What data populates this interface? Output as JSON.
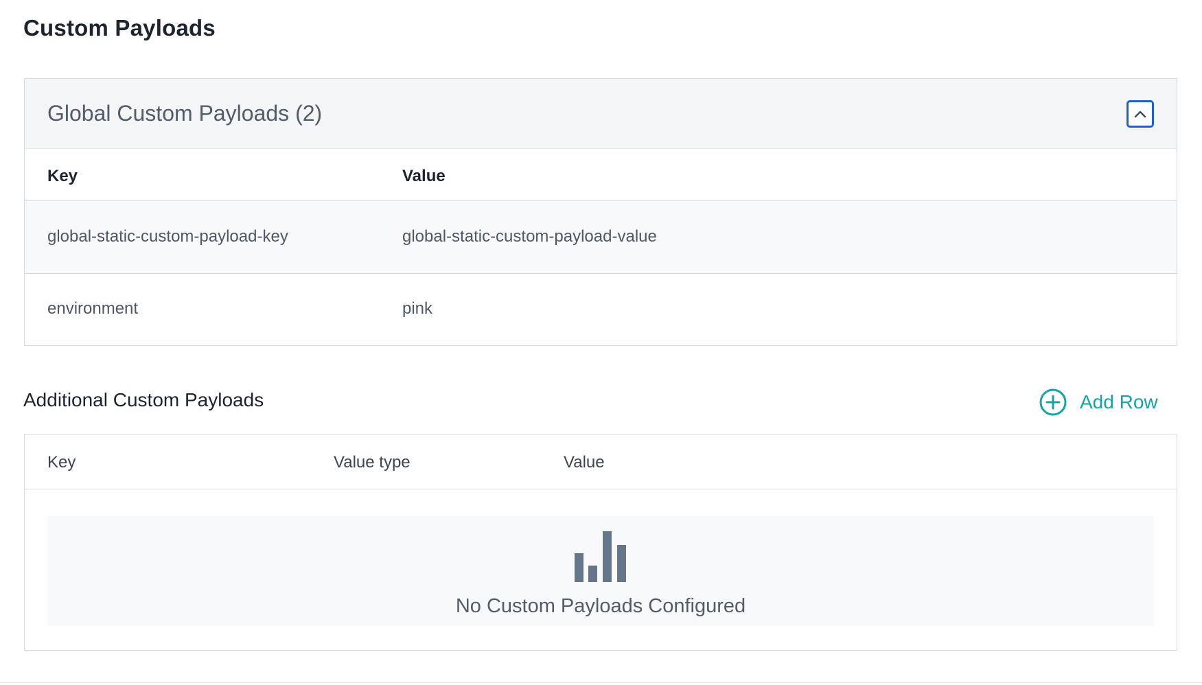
{
  "page": {
    "title": "Custom Payloads"
  },
  "global": {
    "title": "Global Custom Payloads (2)",
    "collapse_icon": "chevron-up-icon",
    "columns": {
      "key": "Key",
      "value": "Value"
    },
    "rows": [
      {
        "key": "global-static-custom-payload-key",
        "value": "global-static-custom-payload-value"
      },
      {
        "key": "environment",
        "value": "pink"
      }
    ]
  },
  "additional": {
    "title": "Additional Custom Payloads",
    "add_row_label": "Add Row",
    "add_row_icon": "plus-circle-icon",
    "columns": {
      "key": "Key",
      "value_type": "Value type",
      "value": "Value"
    },
    "empty_icon": "bar-chart-icon",
    "empty_text": "No Custom Payloads Configured"
  },
  "colors": {
    "accent_teal": "#17a2a6",
    "focus_blue": "#1f5fd1",
    "header_bg": "#f3f5f7",
    "border": "#d6dbe0"
  }
}
